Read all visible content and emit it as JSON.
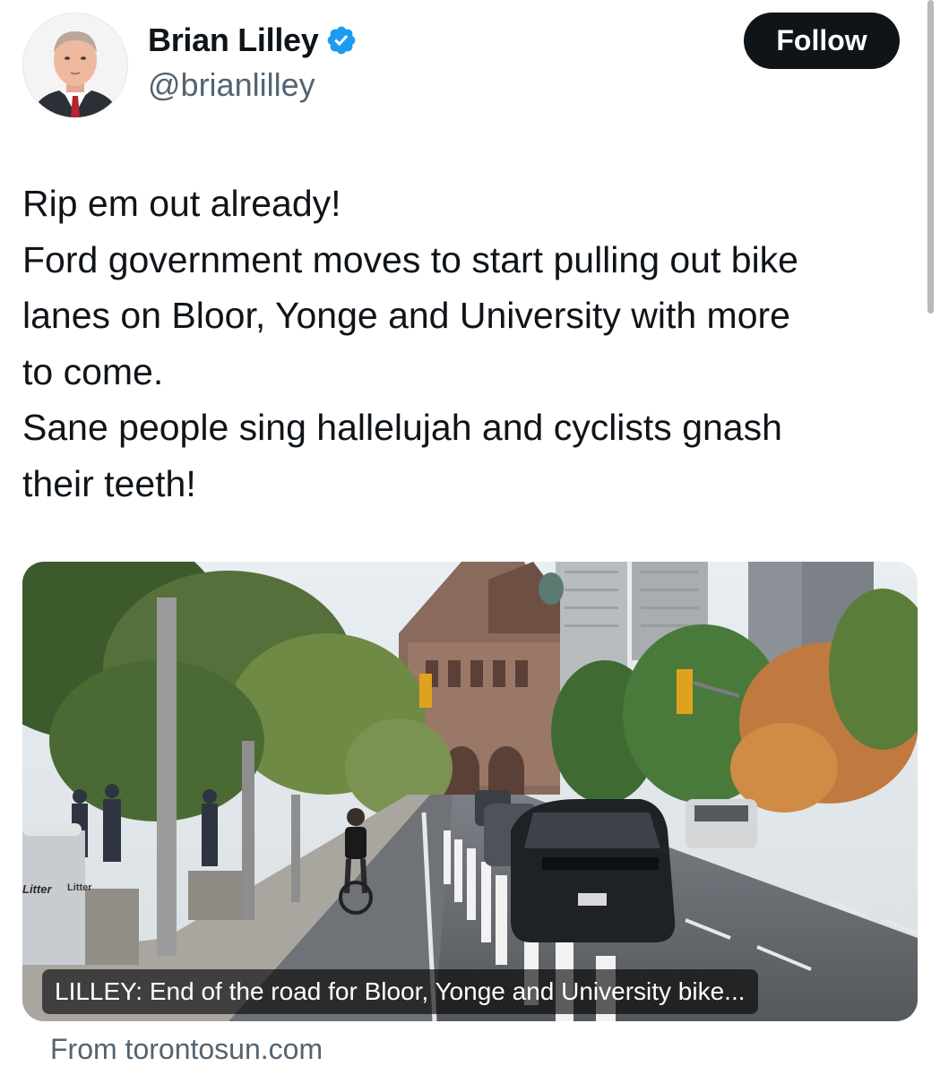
{
  "author": {
    "display_name": "Brian Lilley",
    "handle": "@brianlilley",
    "verified": true,
    "avatar_icon": "profile-photo",
    "verified_icon": "verified-badge-icon"
  },
  "actions": {
    "follow_label": "Follow"
  },
  "tweet": {
    "lines": [
      "Rip em out already!",
      "Ford government moves to start pulling out bike",
      "lanes on Bloor, Yonge and University with more",
      "to come.",
      "Sane people sing hallelujah and cyclists gnash",
      "their teeth!"
    ]
  },
  "link_card": {
    "headline": "LILLEY: End of the road for Bloor, Yonge and University bike...",
    "source": "From torontosun.com",
    "sign_text": [
      "Litter",
      "Litter"
    ]
  },
  "colors": {
    "text": "#0f1419",
    "muted": "#536471",
    "follow_bg": "#0f1419",
    "verified_blue": "#1d9bf0"
  }
}
